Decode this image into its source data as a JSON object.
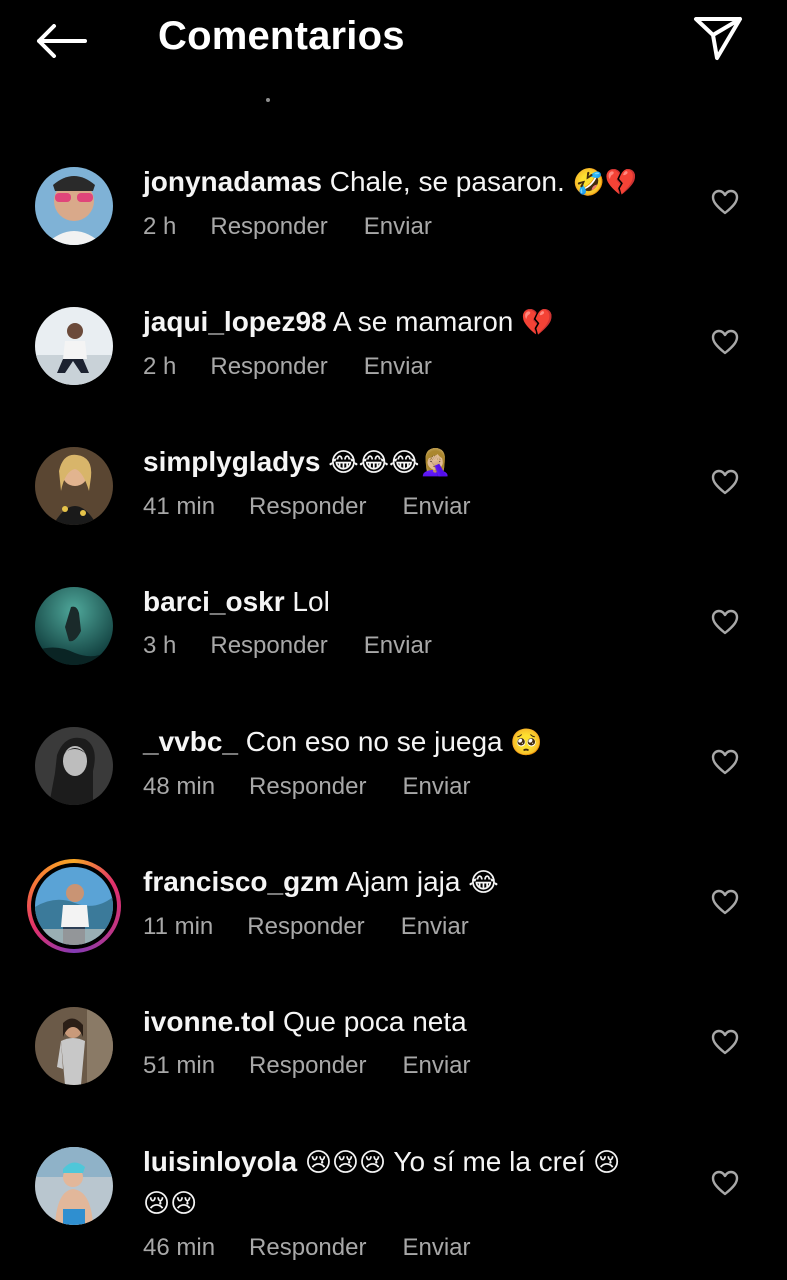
{
  "header": {
    "title": "Comentarios",
    "back_icon": "arrow-left-icon",
    "send_icon": "paper-plane-icon"
  },
  "colors": {
    "background": "#000000",
    "text": "#f5f5f5",
    "meta": "#a8a8a8",
    "story_ring": "#e1306c"
  },
  "comments": [
    {
      "username": "jonynadamas",
      "text": "Chale, se pasaron.",
      "emojis": "🤣💔",
      "time": "2 h",
      "reply": "Responder",
      "send": "Enviar"
    },
    {
      "username": "jaqui_lopez98",
      "text": "A se mamaron",
      "emojis": "💔",
      "time": "2 h",
      "reply": "Responder",
      "send": "Enviar"
    },
    {
      "username": "simplygladys",
      "text": "",
      "emojis": "😂😂😂🤦🏼‍♀️",
      "time": "41 min",
      "reply": "Responder",
      "send": "Enviar"
    },
    {
      "username": "barci_oskr",
      "text": "Lol",
      "emojis": "",
      "time": "3 h",
      "reply": "Responder",
      "send": "Enviar"
    },
    {
      "username": "_vvbc_",
      "text": "Con eso no se juega",
      "emojis": "🥺",
      "time": "48 min",
      "reply": "Responder",
      "send": "Enviar"
    },
    {
      "username": "francisco_gzm",
      "text": "Ajam jaja",
      "emojis": "😂",
      "time": "11 min",
      "reply": "Responder",
      "send": "Enviar",
      "has_story": true
    },
    {
      "username": "ivonne.tol",
      "text": "Que poca neta",
      "emojis": "",
      "time": "51 min",
      "reply": "Responder",
      "send": "Enviar"
    },
    {
      "username": "luisinloyola",
      "text_before": "😢😢😢",
      "text": "Yo sí me la creí",
      "emojis": "😢",
      "text_second_line": "😢😢",
      "time": "46 min",
      "reply": "Responder",
      "send": "Enviar"
    }
  ]
}
